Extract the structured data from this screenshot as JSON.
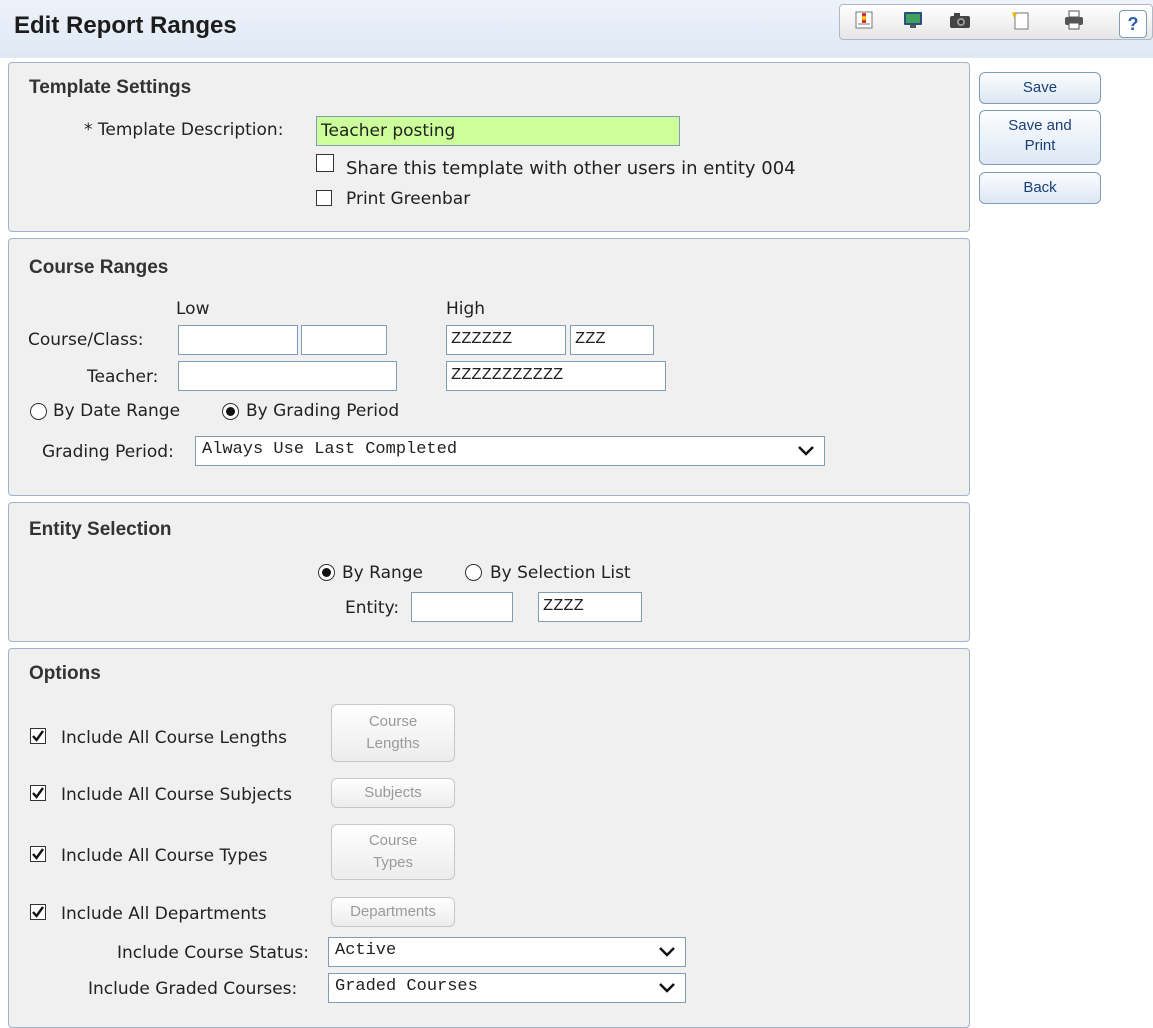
{
  "page": {
    "title": "Edit Report Ranges"
  },
  "toolbar": {
    "icons": [
      "report-icon",
      "monitor-icon",
      "camera-icon",
      "new-document-icon",
      "printer-icon",
      "help-icon"
    ],
    "help_label": "?"
  },
  "actions": {
    "save": "Save",
    "save_print_line1": "Save and",
    "save_print_line2": "Print",
    "back": "Back"
  },
  "template_settings": {
    "title": "Template Settings",
    "description_label": "* Template Description:",
    "description_value": "Teacher posting",
    "share_label": "Share this template with other users in entity 004",
    "share_checked": false,
    "greenbar_label": "Print Greenbar",
    "greenbar_checked": false
  },
  "course_ranges": {
    "title": "Course Ranges",
    "low_header": "Low",
    "high_header": "High",
    "course_class_label": "Course/Class:",
    "course_low": "",
    "class_low": "",
    "course_high": "ZZZZZZ",
    "class_high": "ZZZ",
    "teacher_label": "Teacher:",
    "teacher_low": "",
    "teacher_high": "ZZZZZZZZZZZ",
    "by_date_range_label": "By Date Range",
    "by_grading_period_label": "By Grading Period",
    "selected_mode": "By Grading Period",
    "grading_period_label": "Grading Period:",
    "grading_period_value": "Always Use Last Completed"
  },
  "entity_selection": {
    "title": "Entity Selection",
    "by_range_label": "By Range",
    "by_selection_list_label": "By Selection List",
    "selected_mode": "By Range",
    "entity_label": "Entity:",
    "entity_low": "",
    "entity_high": "ZZZZ"
  },
  "options": {
    "title": "Options",
    "course_lengths_label": "Include All Course Lengths",
    "course_lengths_btn_line1": "Course",
    "course_lengths_btn_line2": "Lengths",
    "subjects_label": "Include All Course Subjects",
    "subjects_btn": "Subjects",
    "types_label": "Include All Course Types",
    "types_btn_line1": "Course",
    "types_btn_line2": "Types",
    "departments_label": "Include All Departments",
    "departments_btn": "Departments",
    "all_checked": true,
    "status_label": "Include Course Status:",
    "status_value": "Active",
    "graded_label": "Include Graded Courses:",
    "graded_value": "Graded Courses"
  },
  "colors": {
    "required_field_bg": "#ccff99",
    "panel_border": "#9fb3cc",
    "panel_bg": "#f0f0f0"
  }
}
